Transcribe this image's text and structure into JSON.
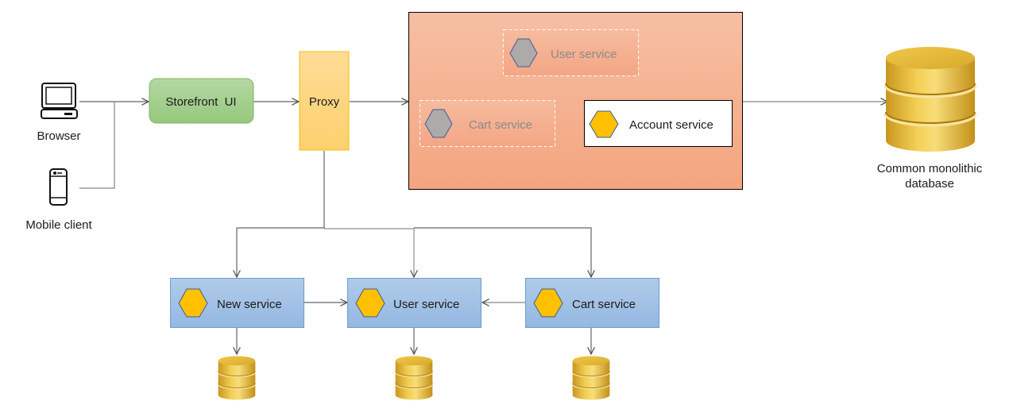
{
  "clients": {
    "browser": {
      "label": "Browser",
      "icon": "laptop-icon"
    },
    "mobile": {
      "label": "Mobile client",
      "icon": "smartphone-icon"
    }
  },
  "storefront": {
    "label": "Storefront  UI"
  },
  "proxy": {
    "label": "Proxy"
  },
  "monolith": {
    "services": [
      {
        "label": "User service",
        "state": "migrated",
        "icon": "hexagon-gray-icon"
      },
      {
        "label": "Cart service",
        "state": "migrated",
        "icon": "hexagon-gray-icon"
      },
      {
        "label": "Account service",
        "state": "active",
        "icon": "hexagon-yellow-icon"
      }
    ]
  },
  "database": {
    "label_line1": "Common monolithic",
    "label_line2": "database",
    "icon": "database-icon"
  },
  "microservices": [
    {
      "label": "New service",
      "icon": "hexagon-yellow-icon"
    },
    {
      "label": "User service",
      "icon": "hexagon-yellow-icon"
    },
    {
      "label": "Cart service",
      "icon": "hexagon-yellow-icon"
    }
  ],
  "colors": {
    "storefront_fill": "#a9d18e",
    "proxy_fill": "#ffd966",
    "monolith_fill": "#f4b183",
    "service_fill": "#9dc3e6",
    "hexagon_active": "#ffc000",
    "hexagon_inactive": "#aeaaaa"
  }
}
